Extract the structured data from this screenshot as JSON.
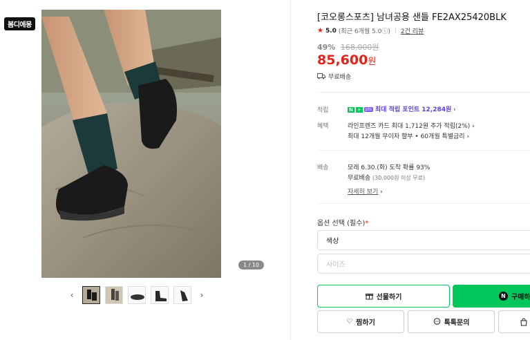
{
  "gallery": {
    "badge": "봄디에몽",
    "counter": "1 / 10",
    "prev_icon": "chevron-left-icon",
    "next_icon": "chevron-right-icon"
  },
  "product": {
    "title": "[코오롱스포츠] 남녀공용 샌들 FE2AX25420BLK",
    "rating": "5.0",
    "rating_note": "(최근 6개월 5.0ⓘ)",
    "reviews": "2건 리뷰",
    "discount_rate": "49%",
    "original_price": "168,000원",
    "price": "85,600",
    "price_unit": "원",
    "shipping": "무료배송"
  },
  "benefits": {
    "points_label": "적립",
    "npay_n": "N",
    "npay_plus": "+",
    "npay_points": "pts",
    "points_text": "최대 적립 포인트 12,284원",
    "perks_label": "혜택",
    "perk_line1": "라인프렌즈 카드 최대 1,712원 추가 적립(2%)",
    "perk_line2": "최대 12개월 무이자 할부 • 60개월 특별금리"
  },
  "delivery": {
    "label": "배송",
    "eta": "모레 6.30.(화) 도착 확률 93%",
    "free": "무료배송",
    "free_note": "(30,000원 이상 무료)",
    "details_link": "자세히 보기"
  },
  "options": {
    "label": "옵션 선택 (필수)",
    "required_mark": "*",
    "color_placeholder": "색상",
    "size_placeholder": "사이즈"
  },
  "actions": {
    "gift": "선물하기",
    "buy": "구매하기",
    "wish": "찜하기",
    "inquiry": "톡톡문의",
    "buy_n": "N"
  },
  "colors": {
    "accent_green": "#03c75a",
    "price_red": "#e2231a",
    "point_purple": "#5c3fe0"
  }
}
